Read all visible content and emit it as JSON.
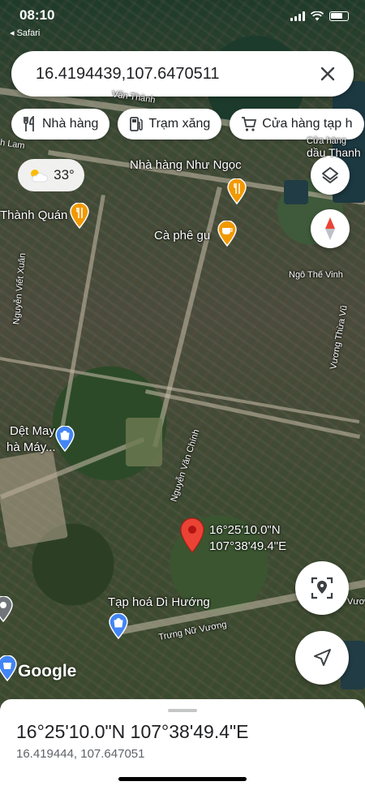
{
  "status_bar": {
    "time": "08:10",
    "back_app": "◂ Safari"
  },
  "search": {
    "value": "16.4194439,107.6470511"
  },
  "chips": [
    {
      "label": "Nhà hàng",
      "icon": "fork-knife-icon"
    },
    {
      "label": "Trạm xăng",
      "icon": "gas-pump-icon"
    },
    {
      "label": "Cửa hàng tạp h",
      "icon": "cart-icon"
    }
  ],
  "weather": {
    "temp": "33°",
    "icon": "partly-sunny-icon"
  },
  "map_labels": {
    "restaurant_1": "Nhà hàng Như Ngọc",
    "restaurant_2": "Thành Quán",
    "cafe": "Cà phê gu",
    "street_1": "Ngô Thế Vinh",
    "street_2": "Vương Thừa Vũ",
    "street_3": "Nguyễn Viết Xuân",
    "street_4": "Nguyễn Văn Chính",
    "street_5": "Trưng Nữ Vương",
    "street_6": "Vươ",
    "street_top": "Văn Thành",
    "street_left": "h Lam",
    "textile_1": "Dệt May",
    "textile_2": "hà Máy...",
    "store": "Tạp hoá Dì Hướng",
    "top_right_1": "Cửa hàng",
    "top_right_2": "dầu Thanh",
    "pin_coord_1": "16°25'10.0\"N",
    "pin_coord_2": "107°38'49.4\"E",
    "google": "Google"
  },
  "sheet": {
    "title": "16°25'10.0\"N 107°38'49.4\"E",
    "subtitle": "16.419444, 107.647051"
  },
  "colors": {
    "pin": "#ea4335",
    "poi_orange": "#f29900",
    "poi_blue": "#4285f4"
  }
}
